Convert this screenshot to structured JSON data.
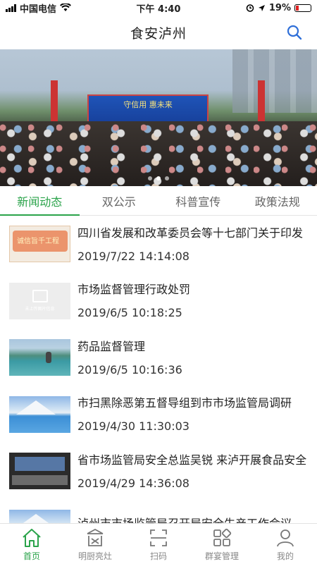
{
  "status": {
    "carrier": "中国电信",
    "time": "下午 4:40",
    "battery": "19%",
    "battery_level": 0.19
  },
  "header": {
    "title": "食安泸州",
    "search_icon": "search-icon"
  },
  "banner": {
    "stage_text": "守信用 惠未来",
    "slides": 3,
    "active_slide": 1
  },
  "tabs": [
    {
      "label": "新闻动态",
      "active": true
    },
    {
      "label": "双公示",
      "active": false
    },
    {
      "label": "科普宣传",
      "active": false
    },
    {
      "label": "政策法规",
      "active": false
    }
  ],
  "news": [
    {
      "title": "四川省发展和改革委员会等十七部门关于印发",
      "date": "2019/7/22 14:14:08",
      "thumb_text": "诚信旨千工程"
    },
    {
      "title": "市场监督管理行政处罚",
      "date": "2019/6/5 10:18:25",
      "thumb_text": "未上传图片信息"
    },
    {
      "title": "药品监督管理",
      "date": "2019/6/5 10:16:36"
    },
    {
      "title": "市扫黑除恶第五督导组到市市场监管局调研",
      "date": "2019/4/30 11:30:03"
    },
    {
      "title": "省市场监管局安全总监吴锐 来泸开展食品安全",
      "date": "2019/4/29 14:36:08"
    },
    {
      "title": "泸州市市场监管局召开局安全生产工作会议",
      "date": ""
    }
  ],
  "tabbar": [
    {
      "label": "首页",
      "icon": "home-icon",
      "active": true
    },
    {
      "label": "明厨亮灶",
      "icon": "kitchen-icon",
      "active": false
    },
    {
      "label": "扫码",
      "icon": "scan-icon",
      "active": false
    },
    {
      "label": "群宴管理",
      "icon": "grid-icon",
      "active": false
    },
    {
      "label": "我的",
      "icon": "user-icon",
      "active": false
    }
  ],
  "colors": {
    "accent": "#2aa34a",
    "battery_low": "#e02020"
  }
}
